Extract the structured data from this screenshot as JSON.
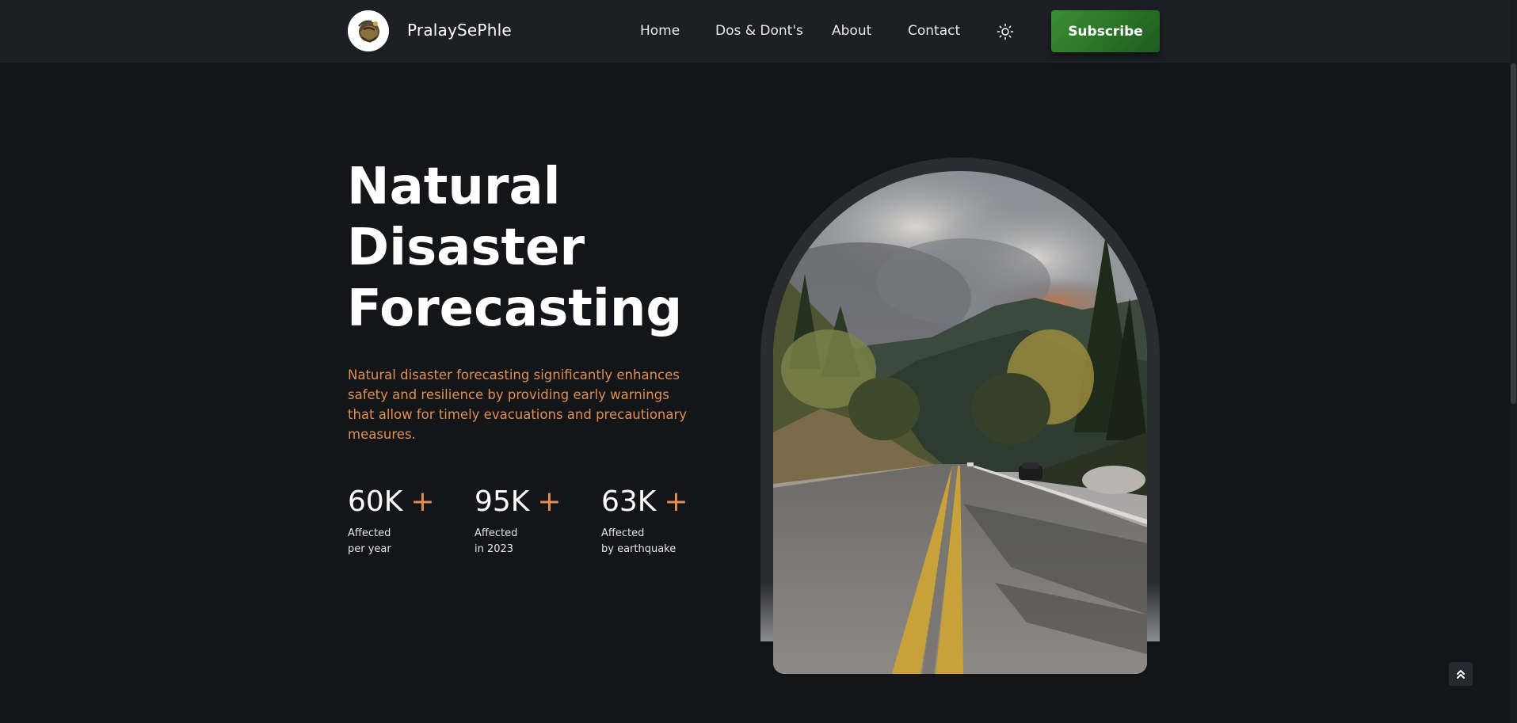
{
  "header": {
    "brand": "PralaySePhle",
    "nav": [
      {
        "label": "Home"
      },
      {
        "label": "Dos & Dont's"
      },
      {
        "label": "About"
      },
      {
        "label": "Contact"
      }
    ],
    "theme_icon": "sun-icon",
    "subscribe_label": "Subscribe"
  },
  "hero": {
    "title_lines": [
      "Natural",
      "Disaster",
      "Forecasting"
    ],
    "description": "Natural disaster forecasting significantly enhances safety and resilience by providing early warnings that allow for timely evacuations and precautionary measures.",
    "stats": [
      {
        "value": "60K",
        "suffix": "+",
        "label_line1": "Affected",
        "label_line2": "per year"
      },
      {
        "value": "95K",
        "suffix": "+",
        "label_line1": "Affected",
        "label_line2": "in 2023"
      },
      {
        "value": "63K",
        "suffix": "+",
        "label_line1": "Affected",
        "label_line2": "by earthquake"
      }
    ],
    "image_icon": "wildfire-road-photo"
  },
  "scroll_top_icon": "double-chevron-up-icon",
  "colors": {
    "background": "#141519",
    "header": "#1d1f25",
    "accent": "#e08f52",
    "subscribe": "#2a7326"
  }
}
